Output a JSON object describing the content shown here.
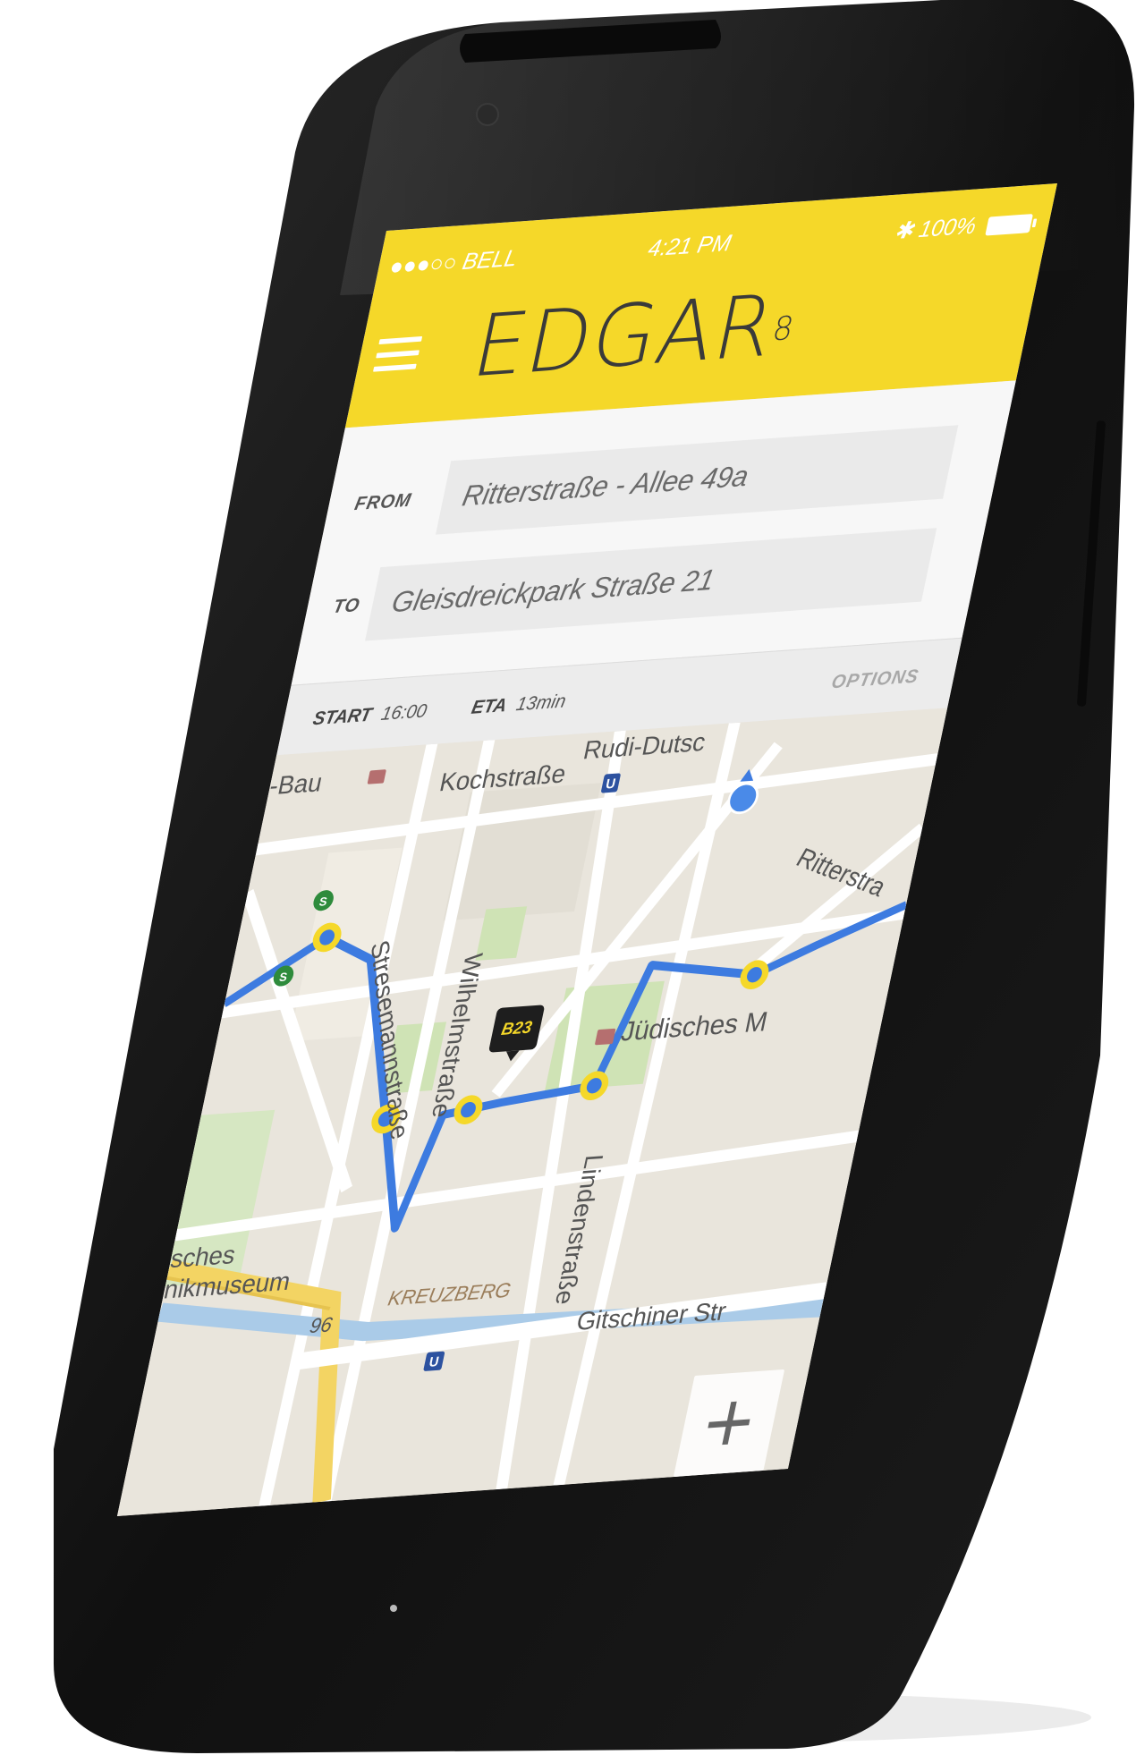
{
  "status_bar": {
    "carrier": "●●●○○ BELL",
    "time": "4:21 PM",
    "battery": "100%"
  },
  "app": {
    "logo": "EDGAR",
    "logo_sup": "8"
  },
  "route": {
    "from_label": "FROM",
    "from_value": "Ritterstraße - Allee 49a",
    "to_label": "TO",
    "to_value": "Gleisdreickpark Straße 21"
  },
  "info_bar": {
    "start_label": "START",
    "start_value": "16:00",
    "eta_label": "ETA",
    "eta_value": "13min",
    "options_label": "OPTIONS"
  },
  "map": {
    "labels": {
      "bau": "-Bau",
      "kochstrasse": "Kochstraße",
      "rudi": "Rudi-Dutsc",
      "ritterstrasse": "Ritterstra",
      "stresemannstrasse": "Stresemannstraße",
      "wilhelmstrasse": "Wilhelmstraße",
      "juedisches": "Jüdisches M",
      "lindenstrasse": "Lindenstraße",
      "museum1": "sches",
      "museum2": "nikmuseum",
      "kreuzberg": "KREUZBERG",
      "road96": "96",
      "gitschiner": "Gitschiner Str"
    },
    "bus_marker": "B23",
    "ubahn_badge": "U",
    "sbahn_badge": "S",
    "route_color": "#3d7be0",
    "accent_color": "#f5d829"
  }
}
